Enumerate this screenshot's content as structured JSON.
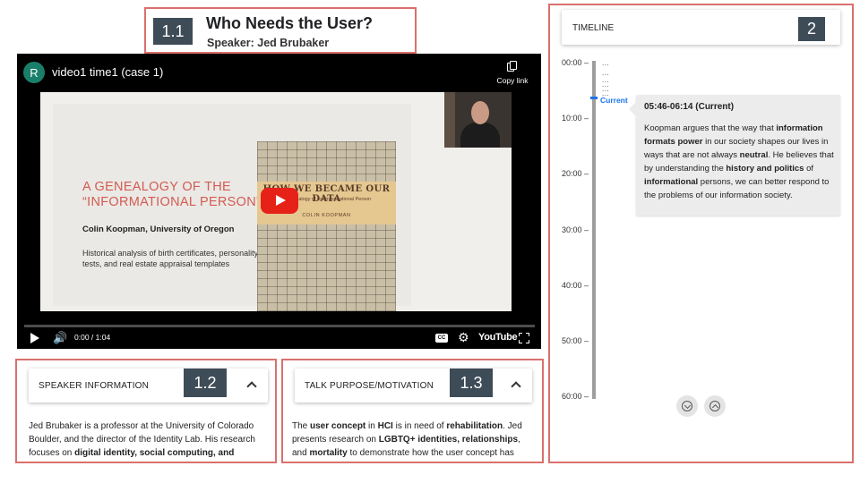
{
  "talk": {
    "badge": "1.1",
    "title": "Who Needs the User?",
    "speaker": "Speaker: Jed Brubaker"
  },
  "video": {
    "channel_initial": "R",
    "title": "video1 time1 (case 1)",
    "copy_link": "Copy link",
    "time": "0:00 / 1:04",
    "cc_icon": "CC",
    "platform": "YouTube",
    "slide": {
      "heading": "A GENEALOGY OF THE “INFORMATIONAL PERSON”",
      "author": "Colin Koopman, University of Oregon",
      "description": "Historical analysis of birth certificates, personality tests, and real estate appraisal templates",
      "book_title": "HOW WE BECAME OUR DATA",
      "book_subtitle": "A Genealogy of the Informational Person",
      "book_author": "COLIN KOOPMAN"
    },
    "icons": [
      "play-icon",
      "volume-icon",
      "cc-icon",
      "settings-icon",
      "fullscreen-icon",
      "copy-link-icon"
    ]
  },
  "speaker_panel": {
    "badge": "1.2",
    "header": "SPEAKER INFORMATION",
    "body_parts": [
      "Jed Brubaker is a professor at the University of Colorado Boulder, and the director of the Identity Lab. His research focuses on ",
      "digital identity, social computing, and human-"
    ]
  },
  "purpose_panel": {
    "badge": "1.3",
    "header": "TALK PURPOSE/MOTIVATION",
    "body_parts": [
      "The ",
      "user concept",
      " in ",
      "HCI",
      " is in need of ",
      "rehabilitation",
      ". Jed presents research on ",
      "LGBTQ+ identities, relationships",
      ", and ",
      "mortality",
      " to demonstrate how the user concept has made"
    ]
  },
  "timeline": {
    "badge": "2",
    "header": "TIMELINE",
    "labels": [
      "00:00 –",
      "10:00 –",
      "20:00 –",
      "30:00 –",
      "40:00 –",
      "50:00 –",
      "60:00 –"
    ],
    "current_label": "Current",
    "dots": [
      "...",
      "...",
      "...",
      "...",
      "...",
      "..."
    ],
    "card": {
      "title": "05:46-06:14 (Current)",
      "body_parts": [
        "Koopman argues that the way that ",
        "information formats power",
        " in our society shapes our lives in ways that are not always ",
        "neutral",
        ". He believes that by understanding the ",
        "history and politics",
        " of ",
        "informational",
        " persons, we can better respond to the problems of our information society."
      ]
    }
  },
  "colors": {
    "annotation_border": "#d9706d",
    "badge_bg": "#3e4c58",
    "current_accent": "#1a73e8",
    "youtube_red": "#e62117",
    "slide_heading": "#d25b52"
  }
}
